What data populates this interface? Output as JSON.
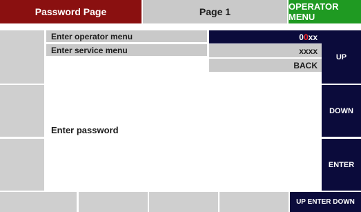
{
  "header": {
    "title": "Password Page",
    "page": "Page 1",
    "menu_button": "OPERATOR MENU"
  },
  "menu": {
    "items": [
      {
        "label": "Enter operator menu",
        "value_prefix": "0",
        "value_highlight": "0",
        "value_suffix": "xx"
      },
      {
        "label": "Enter service menu",
        "value": "xxxx"
      }
    ],
    "back_label": "BACK"
  },
  "prompt": "Enter password",
  "right_buttons": {
    "up": "UP",
    "down": "DOWN",
    "enter": "ENTER"
  },
  "footer": {
    "nav_label": "UP ENTER DOWN"
  },
  "colors": {
    "title_bg": "#8a1010",
    "menu_bg": "#1f9a22",
    "dark_bg": "#0b0b3b",
    "panel_gray": "#c9c9c9",
    "highlight_digit": "#ff2a2a"
  }
}
